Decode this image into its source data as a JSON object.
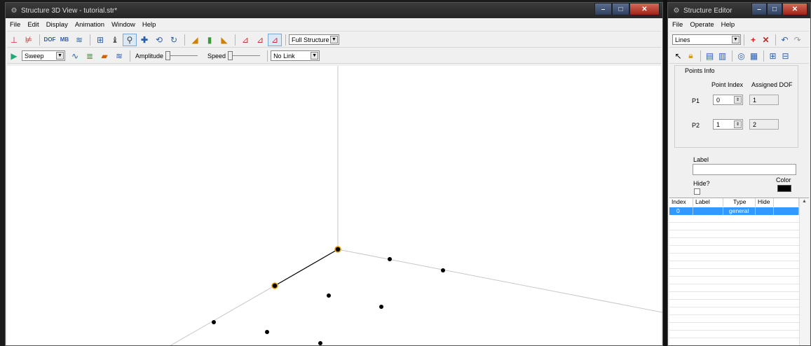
{
  "view3d": {
    "title": "Structure 3D View - tutorial.str*",
    "menu": [
      "File",
      "Edit",
      "Display",
      "Animation",
      "Window",
      "Help"
    ],
    "toolbar_icons": [
      "axis-icon",
      "axis-select-icon",
      "dof-icon",
      "mb-icon",
      "mode-shape-icon",
      "grid-icon",
      "paint-icon",
      "zoom-icon",
      "move-icon",
      "rotate-3d-icon",
      "rotate-icon",
      "surface-icon",
      "bars-icon",
      "shape-icon",
      "xy-view-icon",
      "yz-view-icon",
      "xz-view-icon"
    ],
    "structure_select": "Full Structure",
    "animation_mode": "Sweep",
    "amplitude_label": "Amplitude",
    "speed_label": "Speed",
    "link_select": "No Link",
    "amplitude_level": 0,
    "speed_level": 0
  },
  "editor": {
    "title": "Structure Editor",
    "menu": [
      "File",
      "Operate",
      "Help"
    ],
    "object_type": "Lines",
    "points_info_title": "Points Info",
    "col_point_index": "Point Index",
    "col_assigned_dof": "Assigned DOF",
    "p1_label": "P1",
    "p1_index": "0",
    "p1_dof": "1",
    "p2_label": "P2",
    "p2_index": "1",
    "p2_dof": "2",
    "label_caption": "Label",
    "label_value": "",
    "hide_caption": "Hide?",
    "color_caption": "Color",
    "line_color": "#000000",
    "grid_headers": [
      "Index",
      "Label",
      "Type",
      "Hide"
    ],
    "grid_rows": [
      {
        "index": "0",
        "label": "",
        "type": "general",
        "hide": ""
      }
    ]
  },
  "colors": {
    "selection": "#3399ff",
    "point_highlight": "#e8a000",
    "close_button": "#c0392b"
  }
}
